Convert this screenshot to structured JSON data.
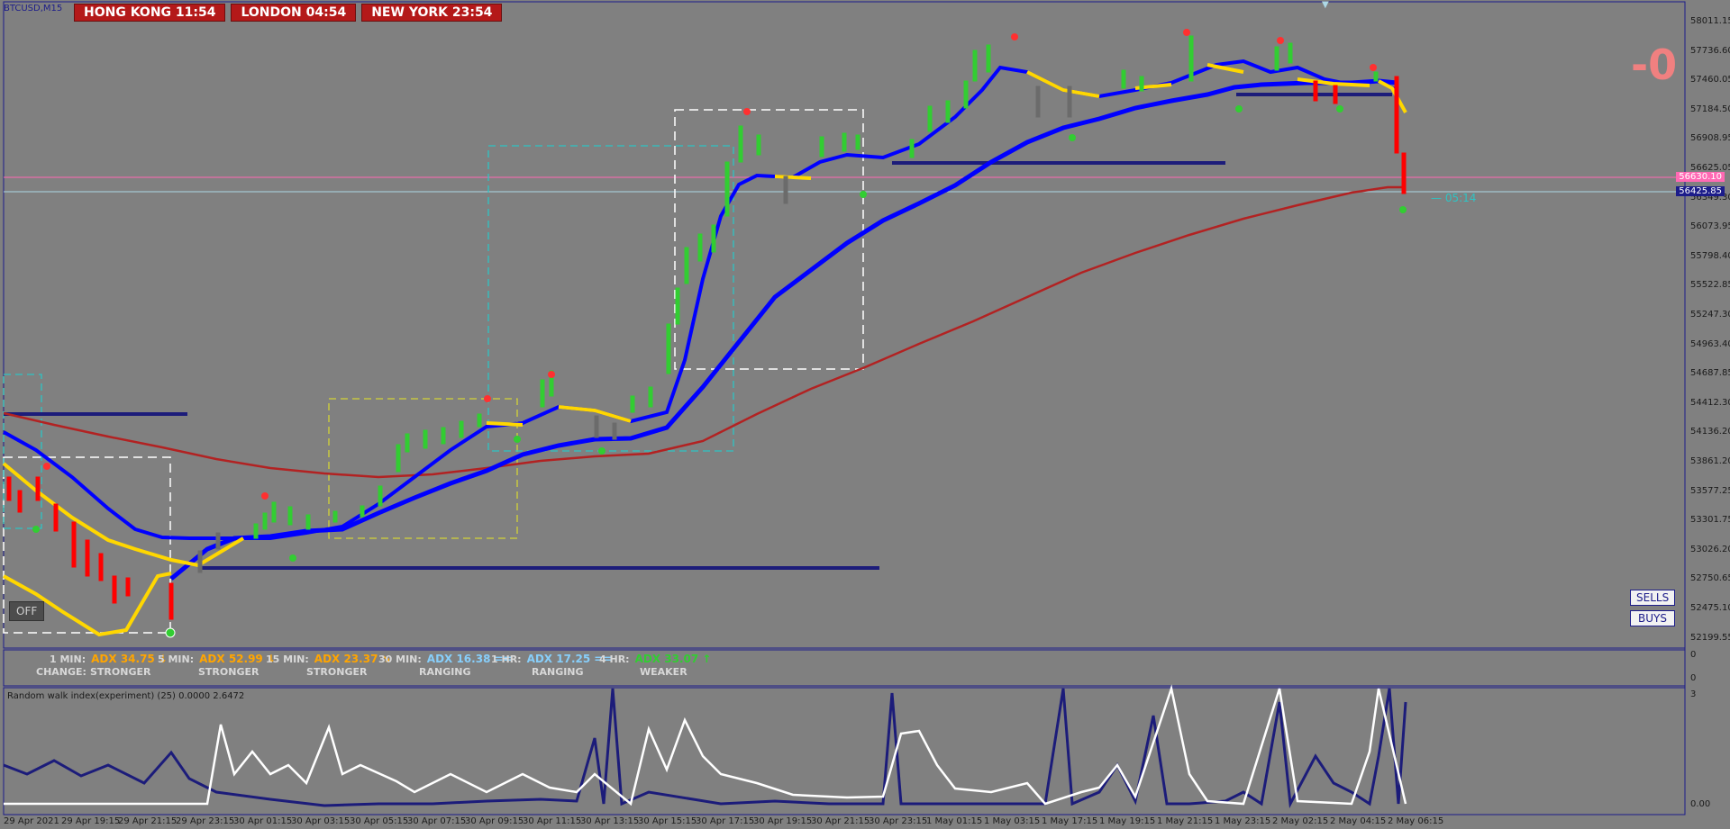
{
  "window": {
    "symbol": "BTCUSD,M15"
  },
  "clocks": [
    {
      "city": "HONG KONG",
      "time": "11:54"
    },
    {
      "city": "LONDON",
      "time": "04:54"
    },
    {
      "city": "NEW YORK",
      "time": "23:54"
    }
  ],
  "indicator": {
    "big_value": "-0",
    "countdown": "05:14",
    "off_label": "OFF"
  },
  "buttons": {
    "sells": "SELLS",
    "buys": "BUYS"
  },
  "price_axis": [
    "58011.15",
    "57736.60",
    "57460.05",
    "57184.50",
    "56908.95",
    "56625.05",
    "56349.30",
    "56073.95",
    "55798.40",
    "55522.85",
    "55247.30",
    "54963.40",
    "54687.85",
    "54412.30",
    "54136.20",
    "53861.20",
    "53577.25",
    "53301.75",
    "53026.20",
    "52750.65",
    "52475.10",
    "52199.55"
  ],
  "price_tags": {
    "pink": "56630.10",
    "current": "56425.85"
  },
  "time_axis": [
    "29 Apr 2021",
    "29 Apr 19:15",
    "29 Apr 21:15",
    "29 Apr 23:15",
    "30 Apr 01:15",
    "30 Apr 03:15",
    "30 Apr 05:15",
    "30 Apr 07:15",
    "30 Apr 09:15",
    "30 Apr 11:15",
    "30 Apr 13:15",
    "30 Apr 15:15",
    "30 Apr 17:15",
    "30 Apr 19:15",
    "30 Apr 21:15",
    "30 Apr 23:15",
    "1 May 01:15",
    "1 May 03:15",
    "1 May 17:15",
    "1 May 19:15",
    "1 May 21:15",
    "1 May 23:15",
    "2 May 02:15",
    "2 May 04:15",
    "2 May 06:15"
  ],
  "adx_panel": [
    {
      "label": "1 MIN:",
      "value": "ADX 34.75",
      "arrow": "↓",
      "color": "#ffa500",
      "state": "STRONGER"
    },
    {
      "label": "5 MIN:",
      "value": "ADX 52.99",
      "arrow": "↓",
      "color": "#ffa500",
      "state": "STRONGER"
    },
    {
      "label": "15 MIN:",
      "value": "ADX 23.37",
      "arrow": "↘",
      "color": "#ffa500",
      "state": "STRONGER"
    },
    {
      "label": "30 MIN:",
      "value": "ADX 16.38",
      "arrow": "==",
      "color": "#87cefa",
      "state": "RANGING"
    },
    {
      "label": "1 HR:",
      "value": "ADX 17.25",
      "arrow": "==",
      "color": "#87cefa",
      "state": "RANGING"
    },
    {
      "label": "4 HR:",
      "value": "ADX 33.07",
      "arrow": "↑",
      "color": "#32cd32",
      "state": "WEAKER"
    }
  ],
  "adx_change_label": "CHANGE:",
  "adx_scale": {
    "top": "0",
    "bottom": "0"
  },
  "rwi": {
    "title": "Random walk index(experiment) (25) 0.0000 2.6472",
    "scale_top": "3",
    "scale_bottom": "0.00"
  },
  "colors": {
    "background": "#808080",
    "bull": "#32cd32",
    "bear": "#ff0000",
    "ma_fast": "#ffd700",
    "ma_slow": "#0000ff",
    "ma_long": "#b22222",
    "level_line": "#1c1c7a",
    "pink_line": "#ff69b4",
    "current_line": "#add8e6"
  }
}
